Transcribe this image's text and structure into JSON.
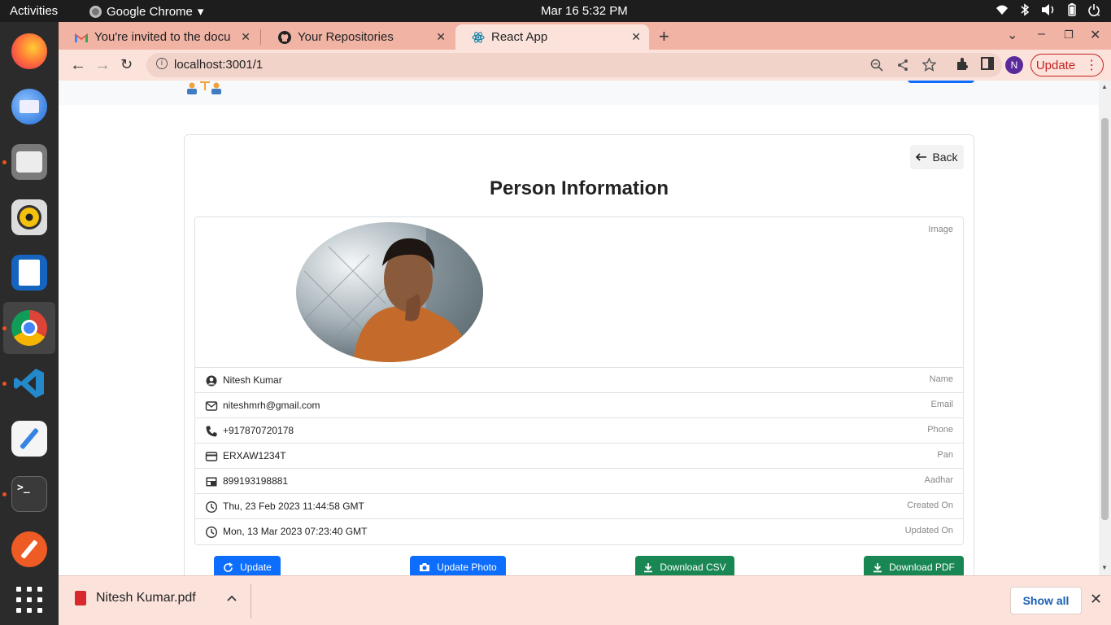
{
  "system": {
    "activities": "Activities",
    "app_name": "Google Chrome",
    "app_caret": "▾",
    "clock": "Mar 16  5:32 PM",
    "tray": [
      "wifi-icon",
      "bluetooth-icon",
      "volume-icon",
      "battery-icon",
      "power-icon"
    ]
  },
  "dock": {
    "items": [
      "firefox",
      "thunderbird",
      "files",
      "rhythmbox",
      "libreoffice-writer",
      "google-chrome",
      "vscode",
      "text-editor",
      "terminal",
      "postman",
      "app-grid"
    ]
  },
  "browser": {
    "tabs": [
      {
        "title": "You're invited to the docu",
        "icon": "gmail-icon"
      },
      {
        "title": "Your Repositories",
        "icon": "github-icon"
      },
      {
        "title": "React App",
        "icon": "react-icon"
      }
    ],
    "close_glyph": "✕",
    "url": "localhost:3001/1",
    "update_label": "Update",
    "avatar_initial": "N"
  },
  "page": {
    "back_label": "Back",
    "title": "Person Information",
    "image_label": "Image",
    "fields": [
      {
        "key": "name",
        "value": "Nitesh Kumar",
        "label": "Name"
      },
      {
        "key": "email",
        "value": "niteshmrh@gmail.com",
        "label": "Email"
      },
      {
        "key": "phone",
        "value": "+917870720178",
        "label": "Phone"
      },
      {
        "key": "pan",
        "value": "ERXAW1234T",
        "label": "Pan"
      },
      {
        "key": "aadhar",
        "value": "899193198881",
        "label": "Aadhar"
      },
      {
        "key": "created",
        "value": "Thu, 23 Feb 2023 11:44:58 GMT",
        "label": "Created On"
      },
      {
        "key": "updated",
        "value": "Mon, 13 Mar 2023 07:23:40 GMT",
        "label": "Updated On"
      }
    ],
    "buttons": {
      "update": "Update",
      "update_photo": "Update Photo",
      "download_csv": "Download CSV",
      "download_pdf": "Download PDF"
    },
    "colors": {
      "primary": "#0d6efd",
      "success": "#198754"
    }
  },
  "downloads": {
    "file": "Nitesh Kumar.pdf",
    "show_all": "Show all"
  }
}
